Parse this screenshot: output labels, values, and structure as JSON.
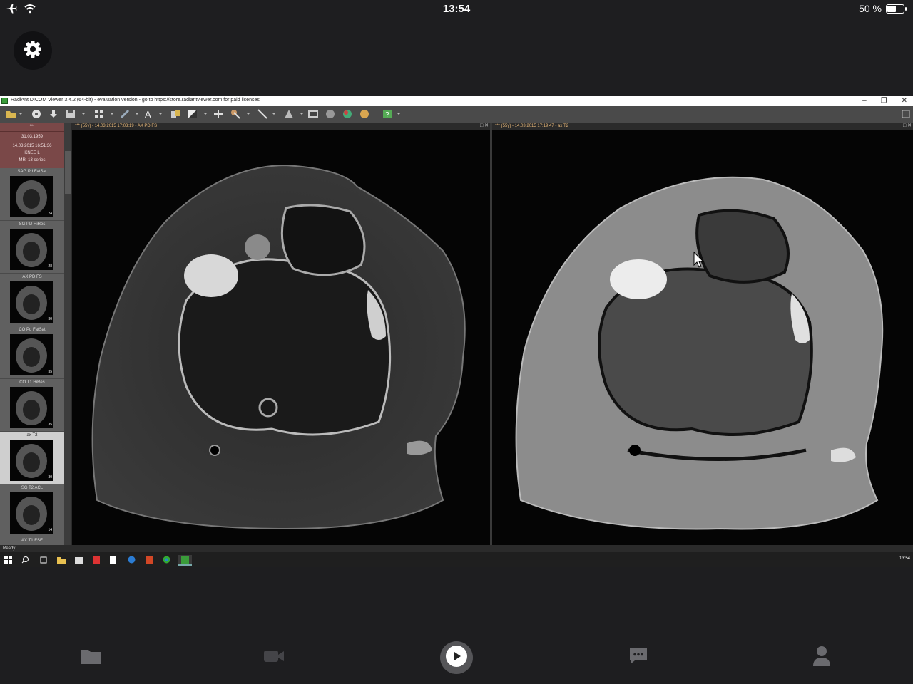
{
  "status_bar": {
    "time": "13:54",
    "battery": "50 %",
    "battery_level": 0.5,
    "icons": [
      "airplane-icon",
      "wifi-icon"
    ]
  },
  "app": {
    "title": "RadiAnt DICOM Viewer 3.4.2 (64-bit) - evaluation version - go to https://store.radiantviewer.com for paid licenses",
    "status": "Ready",
    "taskbar_time": "13:54"
  },
  "patient": {
    "name": "***",
    "birth": "31.03.1959",
    "study_date": "14.03.2015 16:51:36",
    "study_desc": "KNEE L",
    "series_count": "MR: 13 series"
  },
  "series": [
    {
      "label": "SAG Pd FatSat",
      "count": "24"
    },
    {
      "label": "SG PD HiRes",
      "count": "28"
    },
    {
      "label": "AX PD FS",
      "count": "30"
    },
    {
      "label": "CO Pd FatSat",
      "count": "35"
    },
    {
      "label": "CO T1 HiRes",
      "count": "35"
    },
    {
      "label": "ax T2",
      "count": "30"
    },
    {
      "label": "SG T2 ACL",
      "count": "14"
    },
    {
      "label": "AX T1 FSE",
      "count": ""
    }
  ],
  "viewports": {
    "left": {
      "header": "*** (55y) - 14.03.2015 17:03:19 - AX PD FS"
    },
    "right": {
      "header": "*** (55y) - 14.03.2015 17:19:47 - ax T2"
    }
  },
  "bottom_tabs": [
    "folder-icon",
    "video-icon",
    "play-icon",
    "chat-icon",
    "person-icon"
  ]
}
